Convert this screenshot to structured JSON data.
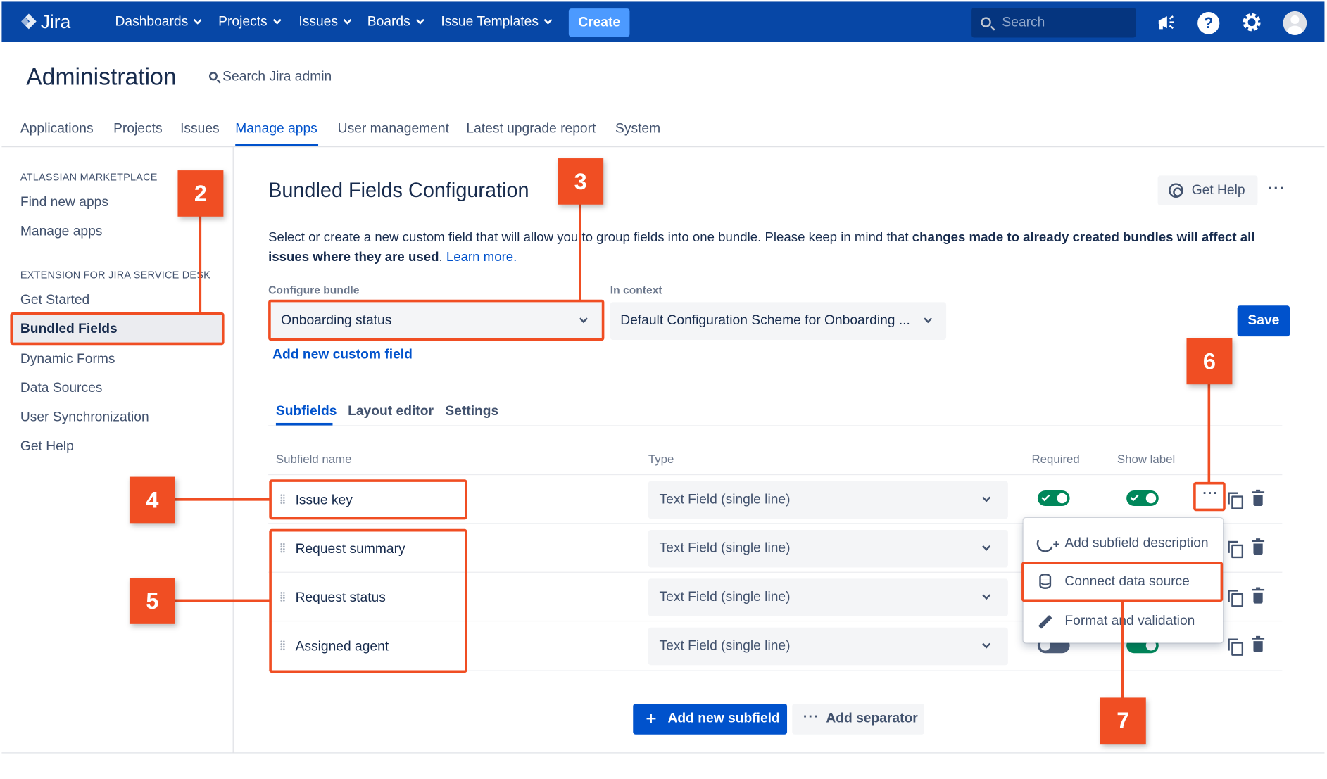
{
  "topnav": {
    "logo": "Jira",
    "items": [
      "Dashboards",
      "Projects",
      "Issues",
      "Boards",
      "Issue Templates"
    ],
    "create_label": "Create",
    "search_placeholder": "Search",
    "icons": [
      "megaphone-icon",
      "help-icon",
      "gear-icon",
      "avatar"
    ],
    "help_glyph": "?",
    "brand_color": "#0747a6",
    "create_color": "#4c9aff"
  },
  "admin": {
    "title": "Administration",
    "search_label": "Search Jira admin",
    "tabs": [
      "Applications",
      "Projects",
      "Issues",
      "Manage apps",
      "User management",
      "Latest upgrade report",
      "System"
    ],
    "active_tab": "Manage apps"
  },
  "sidebar": {
    "sections": [
      {
        "heading": "ATLASSIAN MARKETPLACE",
        "items": [
          "Find new apps",
          "Manage apps"
        ]
      },
      {
        "heading": "EXTENSION FOR JIRA SERVICE DESK",
        "items": [
          "Get Started",
          "Bundled Fields",
          "Dynamic Forms",
          "Data Sources",
          "User Synchronization",
          "Get Help"
        ]
      }
    ],
    "active_item": "Bundled Fields"
  },
  "main": {
    "heading": "Bundled Fields Configuration",
    "get_help_label": "Get Help",
    "more_label": "···",
    "intro_text": "Select or create a new custom field that will allow you to group fields into one bundle. Please keep in mind that ",
    "intro_bold": "changes made to already created bundles will affect all issues where they are used",
    "intro_end": ".",
    "learn_more": "Learn more.",
    "configure_bundle_label": "Configure bundle",
    "configure_bundle_value": "Onboarding status",
    "in_context_label": "In context",
    "in_context_value": "Default Configuration Scheme for Onboarding ...",
    "save_label": "Save",
    "add_custom_field": "Add new custom field",
    "tabs": [
      "Subfields",
      "Layout editor",
      "Settings"
    ],
    "active_tab": "Subfields",
    "columns": {
      "name": "Subfield name",
      "type": "Type",
      "required": "Required",
      "show_label": "Show label"
    },
    "rows": [
      {
        "name": "Issue key",
        "type": "Text Field (single line)",
        "required": true,
        "show_label": true
      },
      {
        "name": "Request summary",
        "type": "Text Field (single line)",
        "required": true,
        "show_label": true
      },
      {
        "name": "Request status",
        "type": "Text Field (single line)",
        "required": true,
        "show_label": true
      },
      {
        "name": "Assigned agent",
        "type": "Text Field (single line)",
        "required": false,
        "show_label": true
      }
    ],
    "row_menu": [
      "Add subfield description",
      "Connect data source",
      "Format and validation"
    ],
    "add_subfield_label": "Add new subfield",
    "add_separator_label": "Add separator",
    "accent_color": "#0052cc",
    "toggle_on_color": "#00875a"
  },
  "annotations": {
    "numbers": [
      "2",
      "3",
      "4",
      "5",
      "6",
      "7"
    ],
    "color": "#f04e23"
  }
}
